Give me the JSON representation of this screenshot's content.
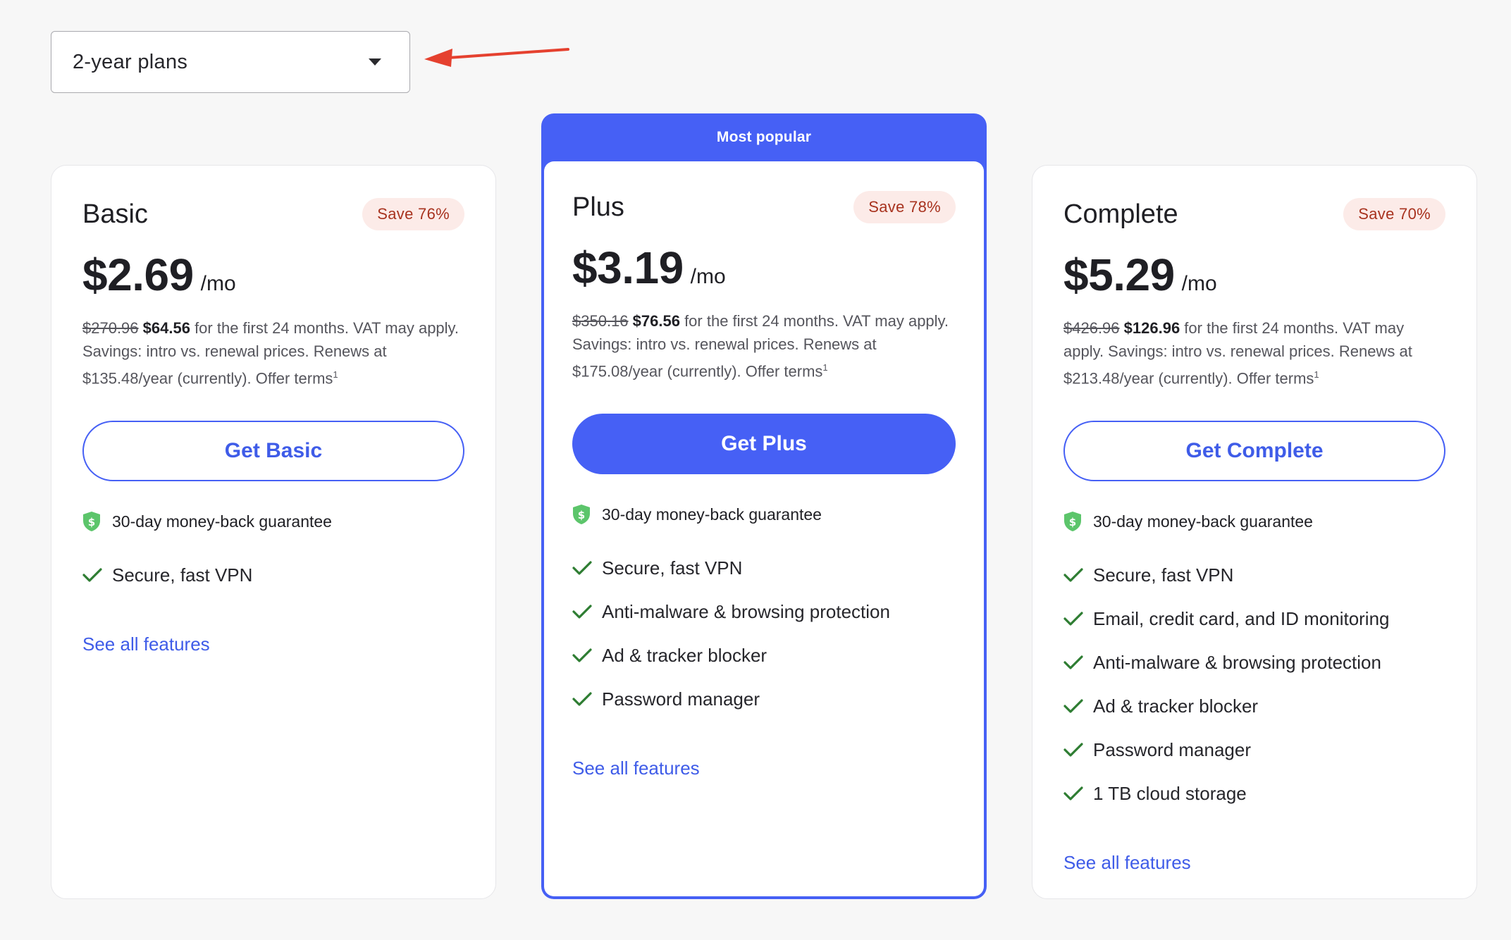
{
  "plan_select": {
    "value": "2-year plans",
    "caret_icon": "chevron-down-icon"
  },
  "annotation": {
    "color": "#e5412f",
    "icon": "arrow-left-icon"
  },
  "colors": {
    "accent": "#4660f5",
    "badge_bg": "#fcebe8",
    "badge_text": "#a8331f",
    "check": "#2e7d32",
    "shield": "#5cc56b"
  },
  "plans": [
    {
      "name": "Basic",
      "save": "Save 76%",
      "price": "$2.69",
      "per": "/mo",
      "old_price": "$270.96",
      "new_price": "$64.56",
      "fine_print": " for the first 24 months. VAT may apply. Savings: intro vs. renewal prices. Renews at $135.48/year (currently). Offer terms",
      "footnote": "1",
      "cta": "Get Basic",
      "guarantee": "30-day money-back guarantee",
      "features": [
        "Secure, fast VPN"
      ],
      "see_all": "See all features"
    },
    {
      "name": "Plus",
      "popular_label": "Most popular",
      "save": "Save 78%",
      "price": "$3.19",
      "per": "/mo",
      "old_price": "$350.16",
      "new_price": "$76.56",
      "fine_print": " for the first 24 months. VAT may apply. Savings: intro vs. renewal prices. Renews at $175.08/year (currently). Offer terms",
      "footnote": "1",
      "cta": "Get Plus",
      "guarantee": "30-day money-back guarantee",
      "features": [
        "Secure, fast VPN",
        "Anti-malware & browsing protection",
        "Ad & tracker blocker",
        "Password manager"
      ],
      "see_all": "See all features"
    },
    {
      "name": "Complete",
      "save": "Save 70%",
      "price": "$5.29",
      "per": "/mo",
      "old_price": "$426.96",
      "new_price": "$126.96",
      "fine_print": " for the first 24 months. VAT may apply. Savings: intro vs. renewal prices. Renews at $213.48/year (currently). Offer terms",
      "footnote": "1",
      "cta": "Get Complete",
      "guarantee": "30-day money-back guarantee",
      "features": [
        "Secure, fast VPN",
        "Email, credit card, and ID monitoring",
        "Anti-malware & browsing protection",
        "Ad & tracker blocker",
        "Password manager",
        "1 TB cloud storage"
      ],
      "see_all": "See all features"
    }
  ]
}
